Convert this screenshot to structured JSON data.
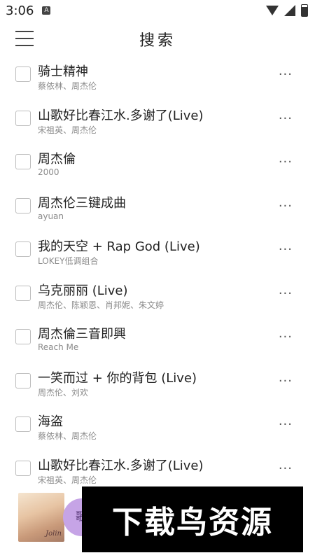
{
  "status_bar": {
    "time": "3:06",
    "app_indicator": "A"
  },
  "header": {
    "title": "搜索"
  },
  "songs": [
    {
      "title": "骑士精神",
      "artist": "蔡依林、周杰伦"
    },
    {
      "title": "山歌好比春江水.多谢了(Live)",
      "artist": "宋祖英、周杰伦"
    },
    {
      "title": "周杰倫",
      "artist": "2000"
    },
    {
      "title": "周杰伦三键成曲",
      "artist": "ayuan"
    },
    {
      "title": "我的天空 + Rap God (Live)",
      "artist": "LOKEY低调组合"
    },
    {
      "title": "乌克丽丽 (Live)",
      "artist": "周杰伦、陈颖恩、肖邦妮、朱文婷"
    },
    {
      "title": "周杰倫三音即興",
      "artist": "Reach Me"
    },
    {
      "title": "一笑而过 + 你的背包 (Live)",
      "artist": "周杰伦、刘欢"
    },
    {
      "title": "海盗",
      "artist": "蔡依林、周杰伦"
    },
    {
      "title": "山歌好比春江水.多谢了(Live)",
      "artist": "宋祖英、周杰伦"
    }
  ],
  "more_glyph": "···",
  "player": {
    "cover_signature": "Jolin",
    "peek_text": "歌"
  },
  "watermark": {
    "text": "下载鸟资源"
  }
}
